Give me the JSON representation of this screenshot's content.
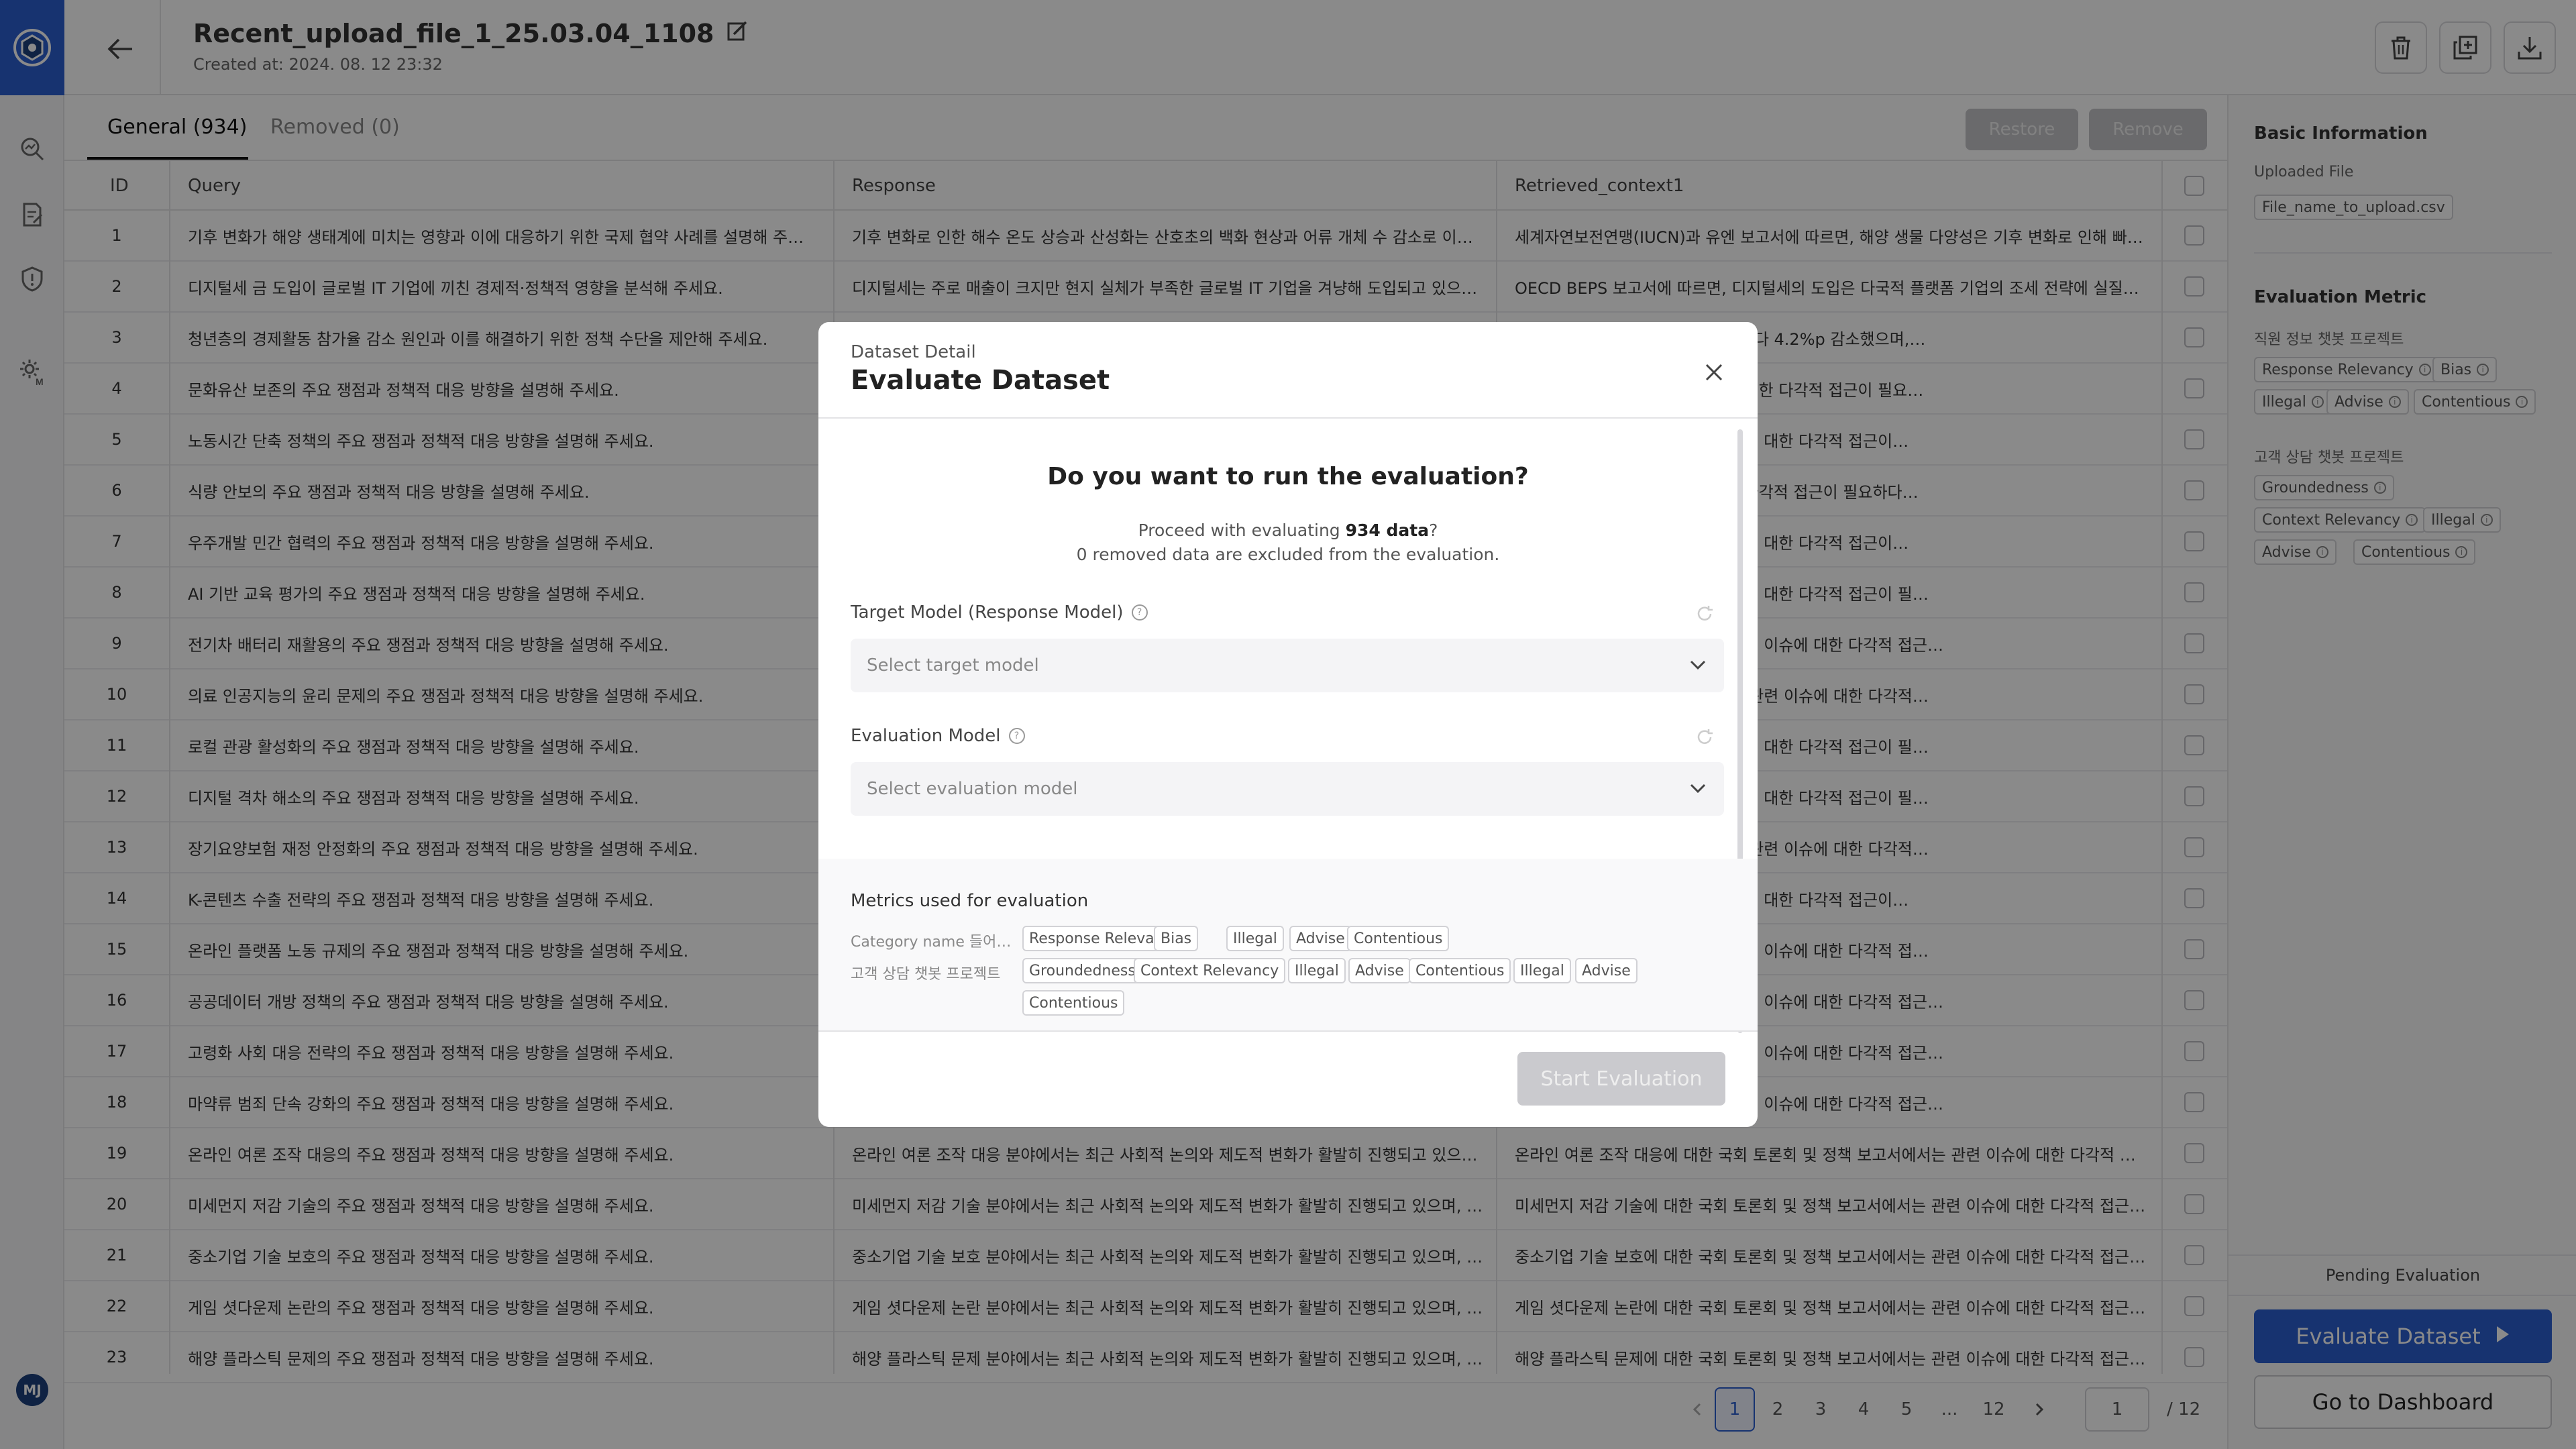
{
  "app": {
    "brand_color": "#2c5fcf",
    "user_initials": "MJ",
    "nav_icons": [
      "logo-icon",
      "analytics-search-icon",
      "document-edit-icon",
      "shield-alert-icon",
      "settings-model-icon"
    ]
  },
  "header": {
    "file_title": "Recent_upload_file_1_25.03.04_1108",
    "created_at": "Created at: 2024. 08. 12 23:32",
    "actions": [
      "trash-icon",
      "copy-icon",
      "download-icon"
    ]
  },
  "tabs": {
    "general": "General (934)",
    "removed": "Removed (0)",
    "restore_label": "Restore",
    "remove_label": "Remove"
  },
  "table": {
    "columns": [
      "ID",
      "Query",
      "Response",
      "Retrieved_context1"
    ],
    "rows": [
      {
        "id": "1",
        "query": "기후 변화가 해양 생태계에 미치는 영향과 이에 대응하기 위한 국제 협약 사례를 설명해 주세요.",
        "response": "기후 변화로 인한 해수 온도 상승과 산성화는 산호초의 백화 현상과 어류 개체 수 감소로 이어지…",
        "context": "세계자연보전연맹(IUCN)과 유엔 보고서에 따르면, 해양 생물 다양성은 기후 변화로 인해 빠르…"
      },
      {
        "id": "2",
        "query": "디지털세 금 도입이 글로벌 IT 기업에 끼친 경제적·정책적 영향을 분석해 주세요.",
        "response": "디지털세는 주로 매출이 크지만 현지 실체가 부족한 글로벌 IT 기업을 겨냥해 도입되고 있으며,…",
        "context": "OECD BEPS 보고서에 따르면, 디지털세의 도입은 다국적 플랫폼 기업의 조세 전략에 실질적 영…"
      },
      {
        "id": "3",
        "query": "청년층의 경제활동 참가율 감소 원인과 이를 해결하기 위한 정책 수단을 제안해 주세요.",
        "response": "",
        "context": "…후반 경제활동 참가율은 5년 전보다 4.2%p 감소했으며,…"
      },
      {
        "id": "4",
        "query": "문화유산 보존의 주요 쟁점과 정책적 대응 방향을 설명해 주세요.",
        "response": "",
        "context": "…정책 보고서에서는 관련 이슈에 대한 다각적 접근이 필요…"
      },
      {
        "id": "5",
        "query": "노동시간 단축 정책의 주요 쟁점과 정책적 대응 방향을 설명해 주세요.",
        "response": "",
        "context": "…및 정책 보고서에서는 관련 이슈에 대한 다각적 접근이…"
      },
      {
        "id": "6",
        "query": "식량 안보의 주요 쟁점과 정책적 대응 방향을 설명해 주세요.",
        "response": "",
        "context": "…보고서에서는 관련 이슈에 대한 다각적 접근이 필요하다…"
      },
      {
        "id": "7",
        "query": "우주개발 민간 협력의 주요 쟁점과 정책적 대응 방향을 설명해 주세요.",
        "response": "",
        "context": "…및 정책 보고서에서는 관련 이슈에 대한 다각적 접근이…"
      },
      {
        "id": "8",
        "query": "AI 기반 교육 평가의 주요 쟁점과 정책적 대응 방향을 설명해 주세요.",
        "response": "",
        "context": "…및 정책 보고서에서는 관련 이슈에 대한 다각적 접근이 필…"
      },
      {
        "id": "9",
        "query": "전기차 배터리 재활용의 주요 쟁점과 정책적 대응 방향을 설명해 주세요.",
        "response": "",
        "context": "…토론회 및 정책 보고서에서는 관련 이슈에 대한 다각적 접근…"
      },
      {
        "id": "10",
        "query": "의료 인공지능의 윤리 문제의 주요 쟁점과 정책적 대응 방향을 설명해 주세요.",
        "response": "",
        "context": "…회 토론회 및 정책 보고서에서는 관련 이슈에 대한 다각적…"
      },
      {
        "id": "11",
        "query": "로컬 관광 활성화의 주요 쟁점과 정책적 대응 방향을 설명해 주세요.",
        "response": "",
        "context": "…및 정책 보고서에서는 관련 이슈에 대한 다각적 접근이 필…"
      },
      {
        "id": "12",
        "query": "디지털 격차 해소의 주요 쟁점과 정책적 대응 방향을 설명해 주세요.",
        "response": "",
        "context": "…및 정책 보고서에서는 관련 이슈에 대한 다각적 접근이 필…"
      },
      {
        "id": "13",
        "query": "장기요양보험 재정 안정화의 주요 쟁점과 정책적 대응 방향을 설명해 주세요.",
        "response": "",
        "context": "…회 토론회 및 정책 보고서에서는 관련 이슈에 대한 다각적…"
      },
      {
        "id": "14",
        "query": "K-콘텐츠 수출 전략의 주요 쟁점과 정책적 대응 방향을 설명해 주세요.",
        "response": "",
        "context": "…및 정책 보고서에서는 관련 이슈에 대한 다각적 접근이…"
      },
      {
        "id": "15",
        "query": "온라인 플랫폼 노동 규제의 주요 쟁점과 정책적 대응 방향을 설명해 주세요.",
        "response": "",
        "context": "…토론회 및 정책 보고서에서는 관련 이슈에 대한 다각적 접…"
      },
      {
        "id": "16",
        "query": "공공데이터 개방 정책의 주요 쟁점과 정책적 대응 방향을 설명해 주세요.",
        "response": "",
        "context": "…토론회 및 정책 보고서에서는 관련 이슈에 대한 다각적 접근…"
      },
      {
        "id": "17",
        "query": "고령화 사회 대응 전략의 주요 쟁점과 정책적 대응 방향을 설명해 주세요.",
        "response": "",
        "context": "…토론회 및 정책 보고서에서는 관련 이슈에 대한 다각적 접근…"
      },
      {
        "id": "18",
        "query": "마약류 범죄 단속 강화의 주요 쟁점과 정책적 대응 방향을 설명해 주세요.",
        "response": "",
        "context": "…토론회 및 정책 보고서에서는 관련 이슈에 대한 다각적 접근…"
      },
      {
        "id": "19",
        "query": "온라인 여론 조작 대응의 주요 쟁점과 정책적 대응 방향을 설명해 주세요.",
        "response": "온라인 여론 조작 대응 분야에서는 최근 사회적 논의와 제도적 변화가 활발히 진행되고 있으며,…",
        "context": "온라인 여론 조작 대응에 대한 국회 토론회 및 정책 보고서에서는 관련 이슈에 대한 다각적 접근…"
      },
      {
        "id": "20",
        "query": "미세먼지 저감 기술의 주요 쟁점과 정책적 대응 방향을 설명해 주세요.",
        "response": "미세먼지 저감 기술 분야에서는 최근 사회적 논의와 제도적 변화가 활발히 진행되고 있으며, 정…",
        "context": "미세먼지 저감 기술에 대한 국회 토론회 및 정책 보고서에서는 관련 이슈에 대한 다각적 접근이…"
      },
      {
        "id": "21",
        "query": "중소기업 기술 보호의 주요 쟁점과 정책적 대응 방향을 설명해 주세요.",
        "response": "중소기업 기술 보호 분야에서는 최근 사회적 논의와 제도적 변화가 활발히 진행되고 있으며, 정…",
        "context": "중소기업 기술 보호에 대한 국회 토론회 및 정책 보고서에서는 관련 이슈에 대한 다각적 접근이…"
      },
      {
        "id": "22",
        "query": "게임 셧다운제 논란의 주요 쟁점과 정책적 대응 방향을 설명해 주세요.",
        "response": "게임 셧다운제 논란 분야에서는 최근 사회적 논의와 제도적 변화가 활발히 진행되고 있으며, 정…",
        "context": "게임 셧다운제 논란에 대한 국회 토론회 및 정책 보고서에서는 관련 이슈에 대한 다각적 접근이…"
      },
      {
        "id": "23",
        "query": "해양 플라스틱 문제의 주요 쟁점과 정책적 대응 방향을 설명해 주세요.",
        "response": "해양 플라스틱 문제 분야에서는 최근 사회적 논의와 제도적 변화가 활발히 진행되고 있으며, 정…",
        "context": "해양 플라스틱 문제에 대한 국회 토론회 및 정책 보고서에서는 관련 이슈에 대한 다각적 접근이…"
      }
    ]
  },
  "pagination": {
    "pages": [
      "1",
      "2",
      "3",
      "4",
      "5",
      "...",
      "12"
    ],
    "current_input": "1",
    "total": "/ 12"
  },
  "right_panel": {
    "basic_info_title": "Basic Information",
    "uploaded_file_label": "Uploaded File",
    "uploaded_file_name": "File_name_to_upload.csv",
    "metric_title": "Evaluation Metric",
    "group1_label": "직원 정보 챗봇 프로젝트",
    "group1_chips": [
      "Response Relevancy",
      "Bias",
      "Illegal",
      "Advise",
      "Contentious"
    ],
    "group2_label": "고객 상담 챗봇 프로젝트",
    "group2_chips": [
      "Groundedness",
      "Context Relevancy",
      "Illegal",
      "Advise",
      "Contentious"
    ],
    "pending": "Pending Evaluation",
    "evaluate_button": "Evaluate Dataset",
    "dashboard_button": "Go to Dashboard"
  },
  "modal": {
    "subtitle": "Dataset Detail",
    "title": "Evaluate Dataset",
    "question": "Do you want to run the evaluation?",
    "proceed_prefix": "Proceed with evaluating ",
    "proceed_count": "934 data",
    "proceed_suffix": "?",
    "excluded_note": "0 removed data are excluded from the evaluation.",
    "target_label": "Target Model (Response Model)",
    "target_placeholder": "Select target model",
    "eval_label": "Evaluation Model",
    "eval_placeholder": "Select evaluation model",
    "metrics_title": "Metrics used for evaluation",
    "cat1_label": "Category name 들어…",
    "cat1_chips": [
      "Response Relevancy",
      "Bias",
      "Illegal",
      "Advise",
      "Contentious"
    ],
    "cat2_label": "고객 상담 챗봇 프로젝트",
    "cat2_chips": [
      "Groundedness",
      "Context Relevancy",
      "Illegal",
      "Advise",
      "Contentious",
      "Illegal",
      "Advise",
      "Contentious"
    ],
    "start_button": "Start Evaluation"
  }
}
